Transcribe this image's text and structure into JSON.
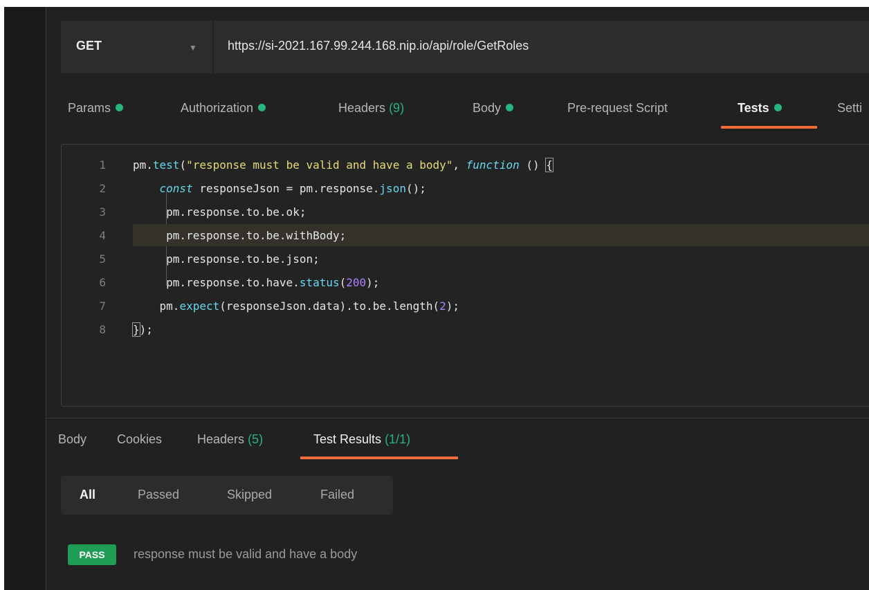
{
  "request": {
    "method": "GET",
    "url": "https://si-2021.167.99.244.168.nip.io/api/role/GetRoles"
  },
  "request_tabs": [
    {
      "label": "Params",
      "dot": true
    },
    {
      "label": "Authorization",
      "dot": true
    },
    {
      "label": "Headers",
      "count": "(9)"
    },
    {
      "label": "Body",
      "dot": true
    },
    {
      "label": "Pre-request Script"
    },
    {
      "label": "Tests",
      "dot": true,
      "active": true
    },
    {
      "label": "Setti"
    }
  ],
  "editor": {
    "line_numbers": [
      "1",
      "2",
      "3",
      "4",
      "5",
      "6",
      "7",
      "8"
    ],
    "lines": [
      [
        {
          "t": "pm."
        },
        {
          "t": "test",
          "c": "fn"
        },
        {
          "t": "("
        },
        {
          "t": "\"response must be valid and have a body\"",
          "c": "str"
        },
        {
          "t": ", "
        },
        {
          "t": "function",
          "c": "kw"
        },
        {
          "t": " () "
        },
        {
          "t": "{",
          "c": "br"
        }
      ],
      [
        {
          "t": "    "
        },
        {
          "t": "const",
          "c": "kw"
        },
        {
          "t": " responseJson = pm.response."
        },
        {
          "t": "json",
          "c": "fn"
        },
        {
          "t": "();"
        }
      ],
      [
        {
          "t": "     pm.response.to.be.ok;"
        }
      ],
      [
        {
          "t": "     pm.response.to.be.withBody;"
        }
      ],
      [
        {
          "t": "     pm.response.to.be.json;"
        }
      ],
      [
        {
          "t": "     pm.response.to.have."
        },
        {
          "t": "status",
          "c": "fn"
        },
        {
          "t": "("
        },
        {
          "t": "200",
          "c": "num"
        },
        {
          "t": ");"
        }
      ],
      [
        {
          "t": "    pm."
        },
        {
          "t": "expect",
          "c": "fn"
        },
        {
          "t": "(responseJson.data).to.be.length("
        },
        {
          "t": "2",
          "c": "num"
        },
        {
          "t": ");"
        }
      ],
      [
        {
          "t": "}",
          "c": "br"
        },
        {
          "t": ");"
        }
      ]
    ],
    "highlighted_line": 4
  },
  "response_tabs": [
    {
      "label": "Body"
    },
    {
      "label": "Cookies"
    },
    {
      "label": "Headers",
      "count": "(5)"
    },
    {
      "label": "Test Results",
      "count": "(1/1)",
      "active": true
    }
  ],
  "filters": [
    "All",
    "Passed",
    "Skipped",
    "Failed"
  ],
  "active_filter": "All",
  "result": {
    "status": "PASS",
    "name": "response must be valid and have a body"
  },
  "colors": {
    "accent": "#f26b3a",
    "green": "#26b47f",
    "pass_badge": "#1f9d55",
    "background": "#212121"
  }
}
